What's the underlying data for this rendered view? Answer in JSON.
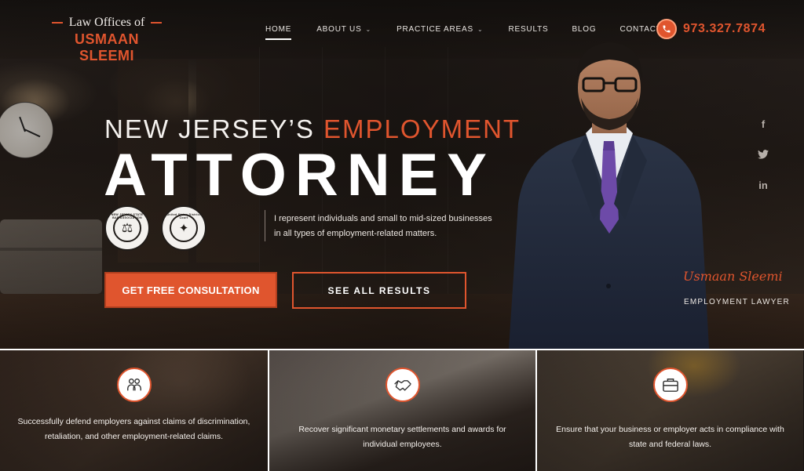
{
  "header": {
    "logo_top": "Law Offices of",
    "logo_name": "USMAAN SLEEMI",
    "phone": "973.327.7874"
  },
  "nav": {
    "items": [
      {
        "label": "HOME",
        "has_dropdown": false,
        "active": true
      },
      {
        "label": "ABOUT US",
        "has_dropdown": true,
        "active": false
      },
      {
        "label": "PRACTICE AREAS",
        "has_dropdown": true,
        "active": false
      },
      {
        "label": "RESULTS",
        "has_dropdown": false,
        "active": false
      },
      {
        "label": "BLOG",
        "has_dropdown": false,
        "active": false
      },
      {
        "label": "CONTACT US",
        "has_dropdown": false,
        "active": false
      }
    ]
  },
  "hero": {
    "headline_prefix": "NEW JERSEY’S",
    "headline_accent": "EMPLOYMENT",
    "headline_main": "ATTORNEY",
    "intro": "I represent individuals and small to mid-sized businesses in all types of employment-related matters.",
    "primary_button": "GET FREE CONSULTATION",
    "secondary_button": "SEE ALL RESULTS",
    "signature": "Usmaan Sleemi",
    "role": "EMPLOYMENT LAWYER",
    "seals": [
      {
        "name": "new-jersey-state-bar-association-seal",
        "label": "NEW JERSEY STATE BAR ASSOCIATION"
      },
      {
        "name": "us-district-court-seal",
        "label": "United States District Court"
      }
    ]
  },
  "social": [
    {
      "name": "facebook-icon",
      "glyph": "f"
    },
    {
      "name": "twitter-icon",
      "glyph": "t"
    },
    {
      "name": "linkedin-icon",
      "glyph": "in"
    }
  ],
  "cards": [
    {
      "icon": "employer-defense-icon",
      "text": "Successfully defend employers against claims of discrimination, retaliation, and other employment-related claims."
    },
    {
      "icon": "handshake-icon",
      "text": "Recover significant monetary settlements and awards for individual employees."
    },
    {
      "icon": "briefcase-icon",
      "text": "Ensure that your business or employer acts in compliance with state and federal laws."
    }
  ],
  "colors": {
    "accent": "#e0552e",
    "dark": "#1a1512",
    "text": "#ffffff"
  }
}
